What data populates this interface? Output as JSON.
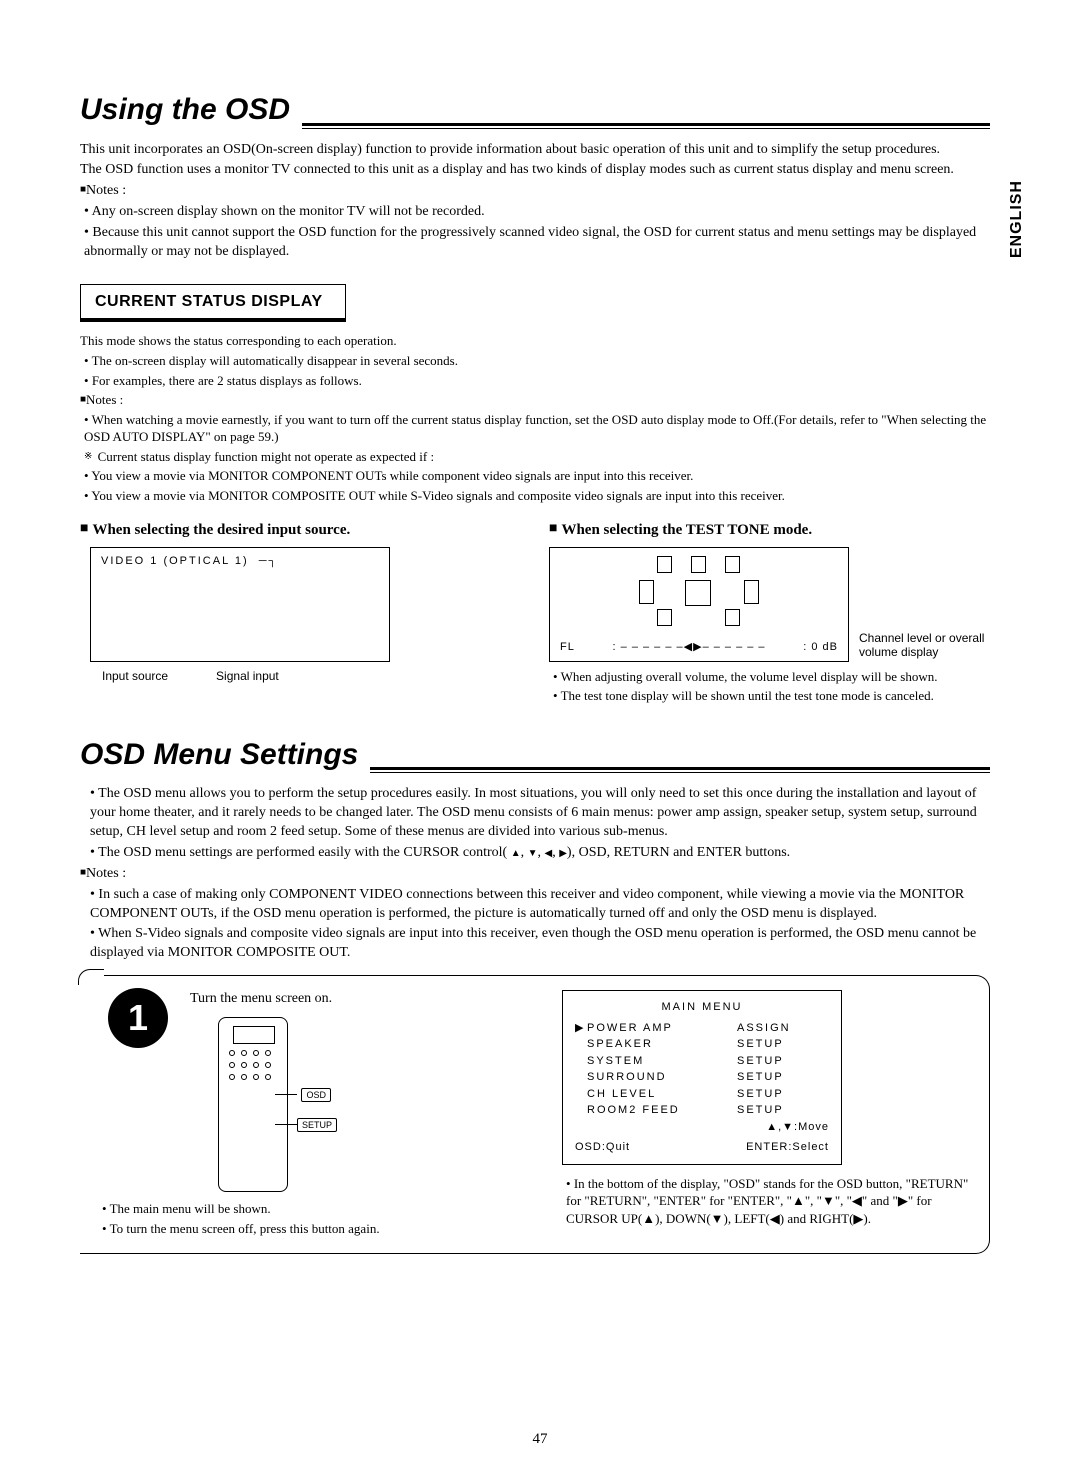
{
  "language_tab": "ENGLISH",
  "page_number": "47",
  "section1": {
    "title": "Using the OSD",
    "intro1": "This unit incorporates an OSD(On-screen display) function to provide information about basic operation of this unit and to simplify the setup procedures.",
    "intro2": "The OSD function uses a monitor TV connected to this unit as a display and has two kinds of display modes such as current status display and menu screen.",
    "notes_label": "Notes :",
    "note1": "Any on-screen display shown on the monitor TV will not be recorded.",
    "note2": "Because this unit cannot support the OSD function for the progressively scanned video signal, the OSD for current status and menu settings may be displayed abnormally or may not be displayed.",
    "csd_header": "CURRENT STATUS DISPLAY",
    "csd1": "This mode shows the status corresponding to each operation.",
    "csd2": "The on-screen display will automatically disappear in several seconds.",
    "csd3": "For examples, there are 2 status displays as follows.",
    "csd_notes_label": "Notes :",
    "csd_note1": "When watching a movie earnestly, if you want to turn off the current status display function, set the OSD auto display mode to Off.(For details, refer to \"When selecting the OSD AUTO DISPLAY\" on page 59.)",
    "csd_ref_label": "Current status display function might not operate as expected if :",
    "csd_ref1": "You view a movie via MONITOR COMPONENT OUTs while component video signals are input into this receiver.",
    "csd_ref2": "You view a movie via MONITOR COMPOSITE OUT while S-Video signals and composite video signals are input into this receiver.",
    "left_subhead": "When selecting the desired input source.",
    "right_subhead": "When selecting the TEST TONE mode.",
    "left_osd_text": "VIDEO 1 (OPTICAL 1)",
    "left_callout1": "Input source",
    "left_callout2": "Signal input",
    "right_fl": "FL",
    "right_sep": ": – – – – – –",
    "right_arrows": "◀▶",
    "right_sep2": "– – – – – –",
    "right_db": ": 0 dB",
    "right_side_label": "Channel level or overall volume display",
    "right_b1": "When adjusting overall volume, the volume level display will be shown.",
    "right_b2": "The test tone display will be shown until the test tone mode is canceled."
  },
  "section2": {
    "title": "OSD Menu Settings",
    "p1": "The OSD menu allows you to perform the setup procedures easily. In most situations, you will only need to set this once during the installation and layout of your home theater, and it rarely needs to be changed later. The OSD menu consists of 6 main menus: power amp assign, speaker setup, system setup, surround setup, CH  level setup and room 2 feed setup. Some of these menus are divided into various sub-menus.",
    "p2a": "The OSD menu settings are performed easily with the CURSOR control(",
    "p2b": "), OSD, RETURN and ENTER buttons.",
    "notes_label": "Notes :",
    "n1": "In such a case of making only COMPONENT VIDEO connections between this receiver and video component, while viewing a movie via the MONITOR COMPONENT OUTs, if the OSD menu operation is performed, the picture is automatically turned off and only the OSD menu is displayed.",
    "n2": "When S-Video signals and composite video signals are input into this receiver, even though the OSD menu operation is performed, the OSD menu cannot be displayed via MONITOR COMPOSITE OUT.",
    "step1_text": "Turn the menu screen on.",
    "osd_btn": "OSD",
    "setup_btn": "SETUP",
    "step1_b1": "The main menu will be shown.",
    "step1_b2": "To turn the menu screen off, press this button again.",
    "menu_title": "MAIN MENU",
    "menu_items": [
      {
        "ptr": "▶",
        "l": "POWER AMP",
        "r": "ASSIGN"
      },
      {
        "ptr": "",
        "l": "SPEAKER",
        "r": "SETUP"
      },
      {
        "ptr": "",
        "l": "SYSTEM",
        "r": "SETUP"
      },
      {
        "ptr": "",
        "l": "SURROUND",
        "r": "SETUP"
      },
      {
        "ptr": "",
        "l": "CH LEVEL",
        "r": "SETUP"
      },
      {
        "ptr": "",
        "l": "ROOM2 FEED",
        "r": "SETUP"
      }
    ],
    "menu_hint_move": "▲,▼:Move",
    "menu_hint_left": "OSD:Quit",
    "menu_hint_right": "ENTER:Select",
    "right_p1": "In the bottom of the display, \"OSD\" stands for the OSD button, \"RETURN\" for \"RETURN\", \"ENTER\" for \"ENTER\", \"▲\", \"▼\", \"◀\" and \"▶\" for CURSOR UP(▲), DOWN(▼), LEFT(◀) and RIGHT(▶)."
  }
}
